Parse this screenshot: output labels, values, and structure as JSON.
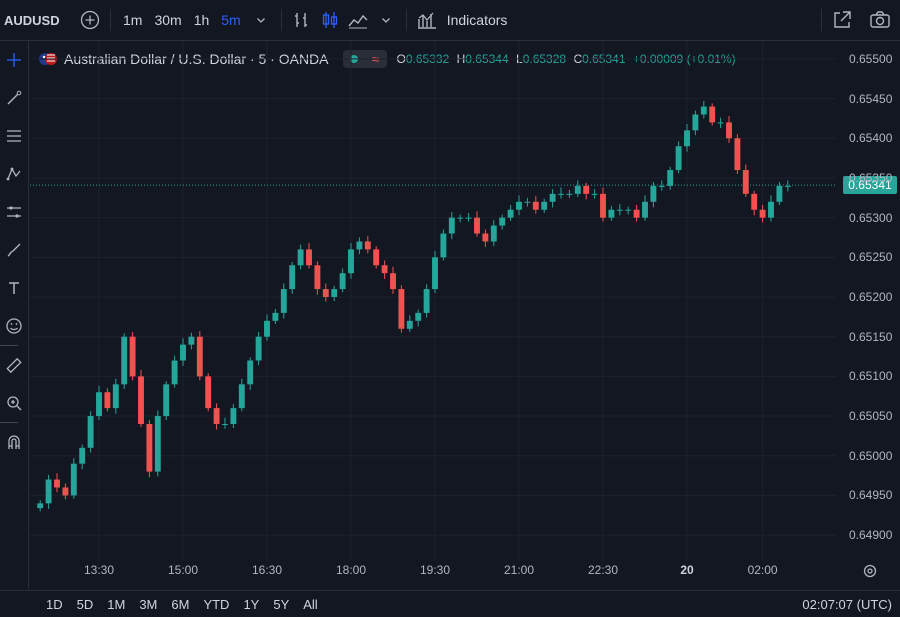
{
  "topbar": {
    "symbol": "AUDUSD",
    "timeframes": [
      "1m",
      "30m",
      "1h",
      "5m"
    ],
    "active_timeframe": "5m",
    "indicators_label": "Indicators"
  },
  "legend": {
    "title": "Australian Dollar / U.S. Dollar · 5 · OANDA",
    "o_key": "O",
    "o_val": "0.65332",
    "h_key": "H",
    "h_val": "0.65344",
    "l_key": "L",
    "l_val": "0.65328",
    "c_key": "C",
    "c_val": "0.65341",
    "change": "+0.00009 (+0.01%)"
  },
  "colors": {
    "up": "#26a69a",
    "down": "#ef5350",
    "background": "#131722",
    "accent": "#2962ff"
  },
  "chart_data": {
    "type": "candlestick",
    "symbol": "AUDUSD",
    "interval": "5",
    "source": "OANDA",
    "y_ticks": [
      "0.65500",
      "0.65450",
      "0.65400",
      "0.65350",
      "0.65300",
      "0.65250",
      "0.65200",
      "0.65150",
      "0.65100",
      "0.65050",
      "0.65000",
      "0.64950",
      "0.64900"
    ],
    "ylim": [
      0.64885,
      0.6551
    ],
    "x_ticks": [
      "13:30",
      "15:00",
      "16:30",
      "18:00",
      "19:30",
      "21:00",
      "22:30",
      "20",
      "02:00"
    ],
    "current_price": "0.65341",
    "closes": [
      0.6494,
      0.6497,
      0.6496,
      0.6495,
      0.6499,
      0.6501,
      0.6505,
      0.6508,
      0.6506,
      0.6509,
      0.6515,
      0.651,
      0.6504,
      0.6498,
      0.6505,
      0.6509,
      0.6512,
      0.6514,
      0.6515,
      0.651,
      0.6506,
      0.6504,
      0.6504,
      0.6506,
      0.6509,
      0.6512,
      0.6515,
      0.6517,
      0.6518,
      0.6521,
      0.6524,
      0.6526,
      0.6524,
      0.6521,
      0.652,
      0.6521,
      0.6523,
      0.6526,
      0.6527,
      0.6526,
      0.6524,
      0.6523,
      0.6521,
      0.6516,
      0.6517,
      0.6518,
      0.6521,
      0.6525,
      0.6528,
      0.653,
      0.653,
      0.653,
      0.6528,
      0.6527,
      0.6529,
      0.653,
      0.6531,
      0.6532,
      0.6532,
      0.6531,
      0.6532,
      0.6533,
      0.6533,
      0.6533,
      0.6534,
      0.6533,
      0.6533,
      0.653,
      0.6531,
      0.6531,
      0.6531,
      0.653,
      0.6532,
      0.6534,
      0.6534,
      0.6536,
      0.6539,
      0.6541,
      0.6543,
      0.6544,
      0.6542,
      0.6542,
      0.654,
      0.6536,
      0.6533,
      0.6531,
      0.653,
      0.6532,
      0.6534,
      0.6534
    ]
  },
  "time_axis": {
    "labels": [
      {
        "text": "13:30",
        "bold": false
      },
      {
        "text": "15:00",
        "bold": false
      },
      {
        "text": "16:30",
        "bold": false
      },
      {
        "text": "18:00",
        "bold": false
      },
      {
        "text": "19:30",
        "bold": false
      },
      {
        "text": "21:00",
        "bold": false
      },
      {
        "text": "22:30",
        "bold": false
      },
      {
        "text": "20",
        "bold": true
      },
      {
        "text": "02:00",
        "bold": false
      }
    ]
  },
  "bottombar": {
    "ranges": [
      "1D",
      "5D",
      "1M",
      "3M",
      "6M",
      "YTD",
      "1Y",
      "5Y",
      "All"
    ],
    "clock": "02:07:07 (UTC)"
  }
}
